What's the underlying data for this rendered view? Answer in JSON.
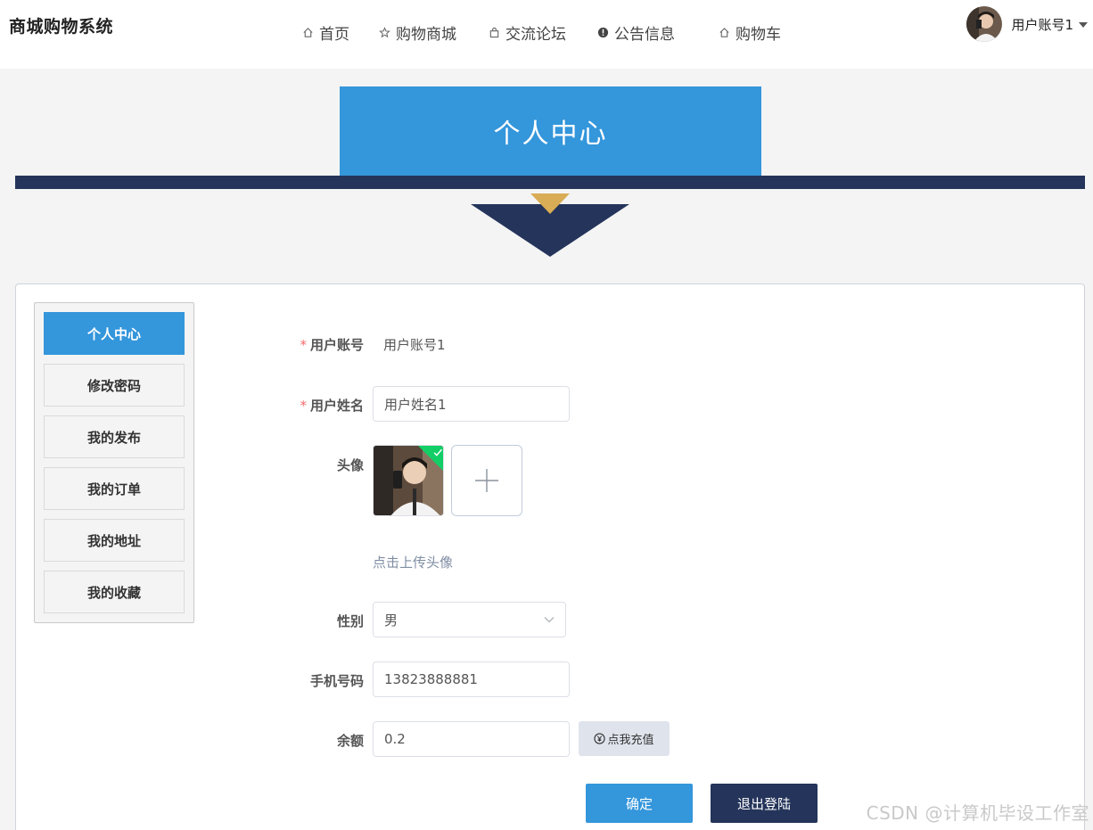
{
  "app_title": "商城购物系统",
  "nav": {
    "items": [
      {
        "label": "首页",
        "icon": "home-icon"
      },
      {
        "label": "购物商城",
        "icon": "star-icon"
      },
      {
        "label": "交流论坛",
        "icon": "bag-icon"
      },
      {
        "label": "公告信息",
        "icon": "info-icon"
      },
      {
        "label": "购物车",
        "icon": "home-icon"
      }
    ]
  },
  "user": {
    "name": "用户账号1"
  },
  "banner": {
    "title": "个人中心"
  },
  "sidebar": {
    "items": [
      {
        "label": "个人中心",
        "active": true
      },
      {
        "label": "修改密码"
      },
      {
        "label": "我的发布"
      },
      {
        "label": "我的订单"
      },
      {
        "label": "我的地址"
      },
      {
        "label": "我的收藏"
      }
    ]
  },
  "form": {
    "account": {
      "label": "用户账号",
      "required": "*",
      "value": "用户账号1"
    },
    "name": {
      "label": "用户姓名",
      "required": "*",
      "value": "用户姓名1"
    },
    "avatar": {
      "label": "头像",
      "hint": "点击上传头像"
    },
    "gender": {
      "label": "性别",
      "value": "男"
    },
    "phone": {
      "label": "手机号码",
      "value": "13823888881"
    },
    "balance": {
      "label": "余额",
      "value": "0.2",
      "recharge_label": "点我充值"
    },
    "confirm_label": "确定",
    "logout_label": "退出登陆"
  },
  "watermark": "CSDN @计算机毕设工作室",
  "colors": {
    "primary": "#3496db",
    "navy": "#24345a",
    "gold": "#d8ad55",
    "success": "#13ce66"
  }
}
